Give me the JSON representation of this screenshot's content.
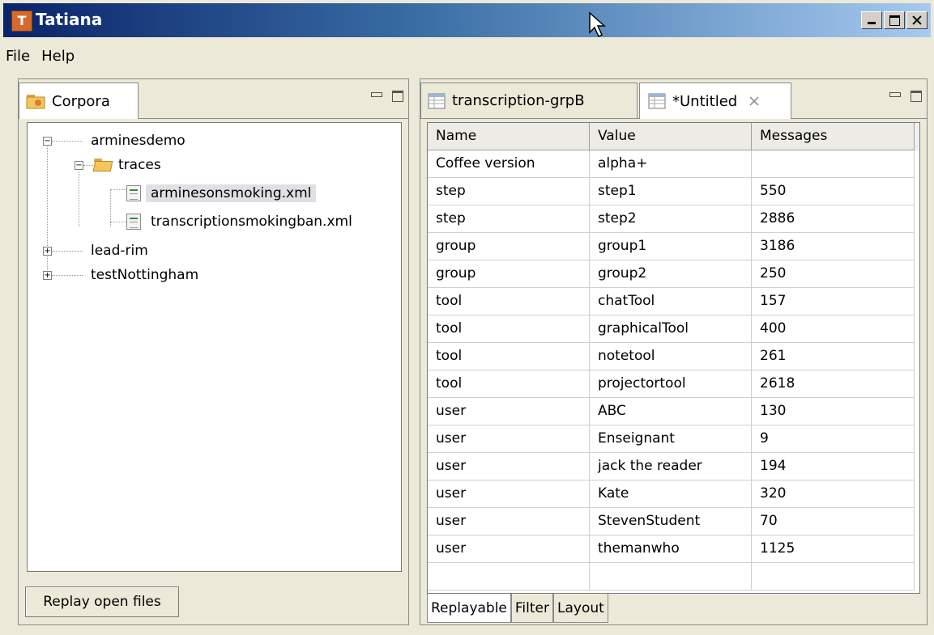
{
  "window": {
    "title": "Tatiana",
    "icon": "tatiana-app-icon"
  },
  "menu": [
    "File",
    "Help"
  ],
  "left_panel": {
    "tab_label": "Corpora",
    "tree": [
      {
        "label": "arminesdemo",
        "expanded": true
      },
      {
        "label": "traces",
        "expanded": true
      },
      {
        "label": "arminesonsmoking.xml",
        "selected": true
      },
      {
        "label": "transcriptionsmokingban.xml"
      },
      {
        "label": "lead-rim",
        "expanded": false
      },
      {
        "label": "testNottingham",
        "expanded": false
      }
    ],
    "replay_button": "Replay open files"
  },
  "right_panel": {
    "tabs": [
      {
        "label": "transcription-grpB"
      },
      {
        "label": "*Untitled",
        "active": true
      }
    ],
    "columns": [
      "Name",
      "Value",
      "Messages"
    ],
    "rows": [
      [
        "Coffee version",
        "alpha+",
        ""
      ],
      [
        "step",
        "step1",
        "550"
      ],
      [
        "step",
        "step2",
        "2886"
      ],
      [
        "group",
        "group1",
        "3186"
      ],
      [
        "group",
        "group2",
        "250"
      ],
      [
        "tool",
        "chatTool",
        "157"
      ],
      [
        "tool",
        "graphicalTool",
        "400"
      ],
      [
        "tool",
        "notetool",
        "261"
      ],
      [
        "tool",
        "projectortool",
        "2618"
      ],
      [
        "user",
        "ABC",
        "130"
      ],
      [
        "user",
        "Enseignant",
        "9"
      ],
      [
        "user",
        "jack the reader",
        "194"
      ],
      [
        "user",
        "Kate",
        "320"
      ],
      [
        "user",
        "StevenStudent",
        "70"
      ],
      [
        "user",
        "themanwho",
        "1125"
      ],
      [
        "",
        "",
        ""
      ]
    ],
    "bottom_tabs": [
      {
        "label": "Replayable",
        "active": true
      },
      {
        "label": "Filter"
      },
      {
        "label": "Layout"
      }
    ]
  }
}
